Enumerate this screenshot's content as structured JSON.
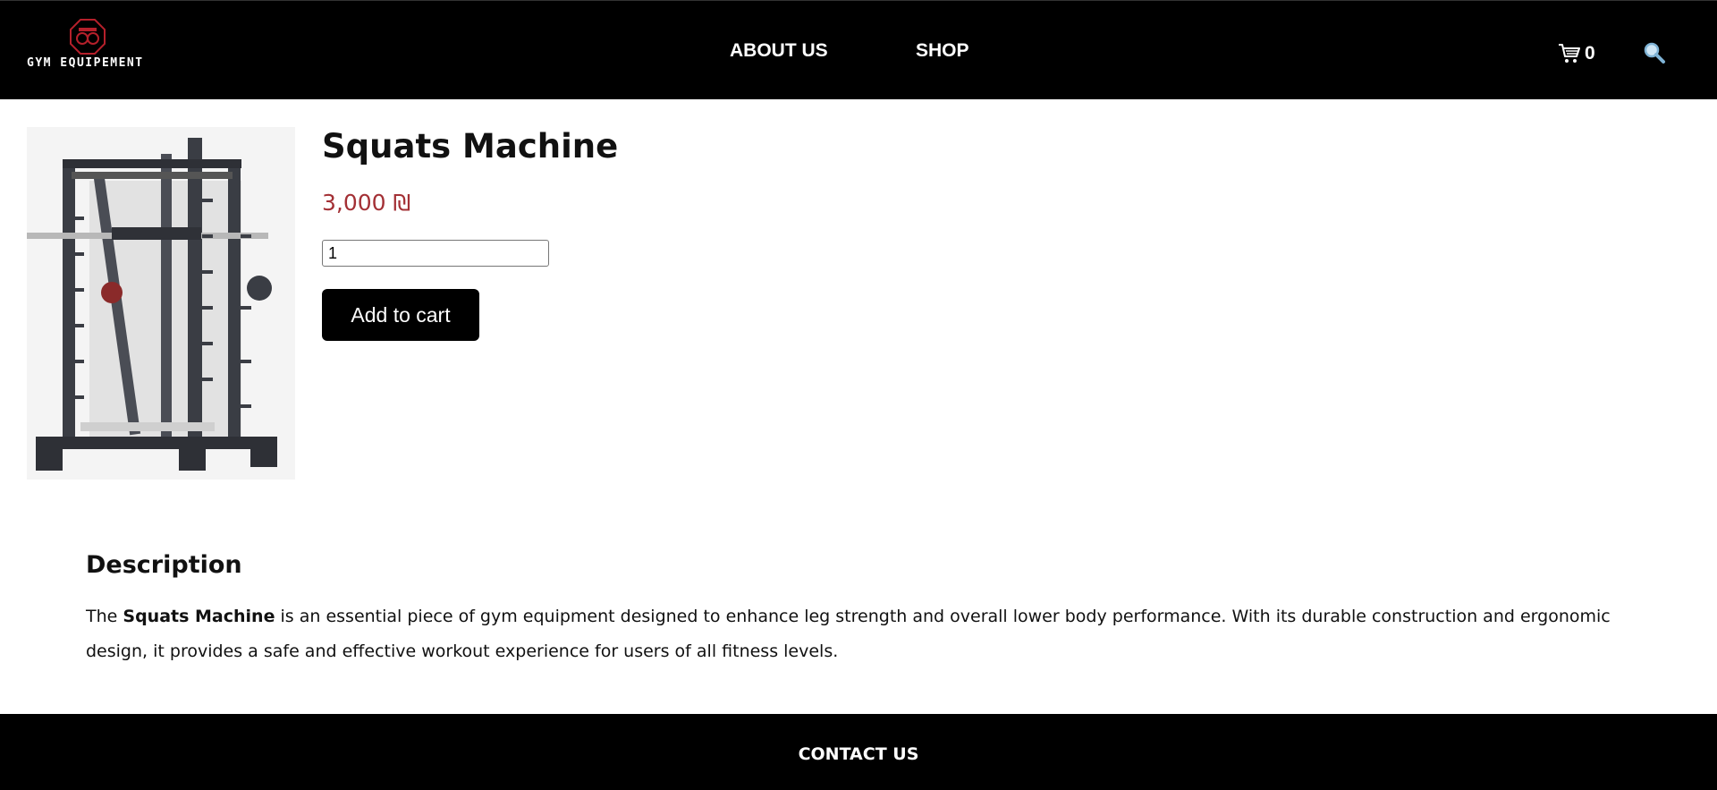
{
  "header": {
    "logo_text": "GYM EQUIPEMENT",
    "nav": [
      {
        "label": "ABOUT US"
      },
      {
        "label": "SHOP"
      }
    ],
    "cart_count": "0",
    "icons": {
      "cart": "cart-icon",
      "search": "search-icon",
      "logo": "gym-logo-icon"
    }
  },
  "product": {
    "title": "Squats Machine",
    "price": "3,000 ₪",
    "quantity": "1",
    "add_to_cart_label": "Add to cart",
    "image_alt": "squats-machine-image"
  },
  "description": {
    "heading": "Description",
    "intro": "The ",
    "product_name": "Squats Machine",
    "body": " is an essential piece of gym equipment designed to enhance leg strength and overall lower body performance. With its durable construction and ergonomic design, it provides a safe and effective workout experience for users of all fitness levels."
  },
  "footer": {
    "contact_label": "CONTACT US"
  },
  "colors": {
    "header_bg": "#000000",
    "price": "#a33035",
    "logo_accent": "#b5202b",
    "button_bg": "#000000"
  }
}
